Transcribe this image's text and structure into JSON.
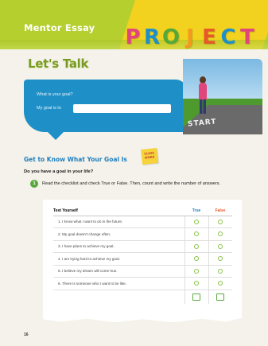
{
  "header": {
    "mentor_label": "Mentor Essay",
    "project_letters": [
      {
        "char": "P",
        "color": "#e0457b"
      },
      {
        "char": "R",
        "color": "#1f8fc7"
      },
      {
        "char": "O",
        "color": "#57a83b"
      },
      {
        "char": "J",
        "color": "#f29a1f"
      },
      {
        "char": "E",
        "color": "#e65a2a"
      },
      {
        "char": "C",
        "color": "#1f8fc7"
      },
      {
        "char": "T",
        "color": "#e0457b"
      }
    ]
  },
  "lets_talk": {
    "title": "Let's Talk",
    "question": "What is your goal?",
    "prompt": "My goal is to"
  },
  "photo": {
    "road_text": "START"
  },
  "section": {
    "title": "Get to Know What Your Goal Is",
    "badge": [
      "CLASS",
      "WORK"
    ],
    "question": "Do you have a goal in your life?",
    "step_number": "1",
    "instruction": "Read the checklist and check True or False. Then, count and write the number of answers."
  },
  "checklist": {
    "headers": [
      "Test Yourself",
      "True",
      "False"
    ],
    "rows": [
      "1. I know what I want to do in the future.",
      "2. My goal doesn't change often.",
      "3. I have plans to achieve my goal.",
      "4. I am trying hard to achieve my goal.",
      "5. I believe my dream will come true.",
      "6. There is someone who I want to be like."
    ]
  },
  "colors": {
    "header_green": "#b4cf2e",
    "header_yellow": "#f2d21e",
    "blue": "#1f8fc7",
    "true_color": "#1f7fbf",
    "false_color": "#e65a2a"
  },
  "page_number": "16"
}
